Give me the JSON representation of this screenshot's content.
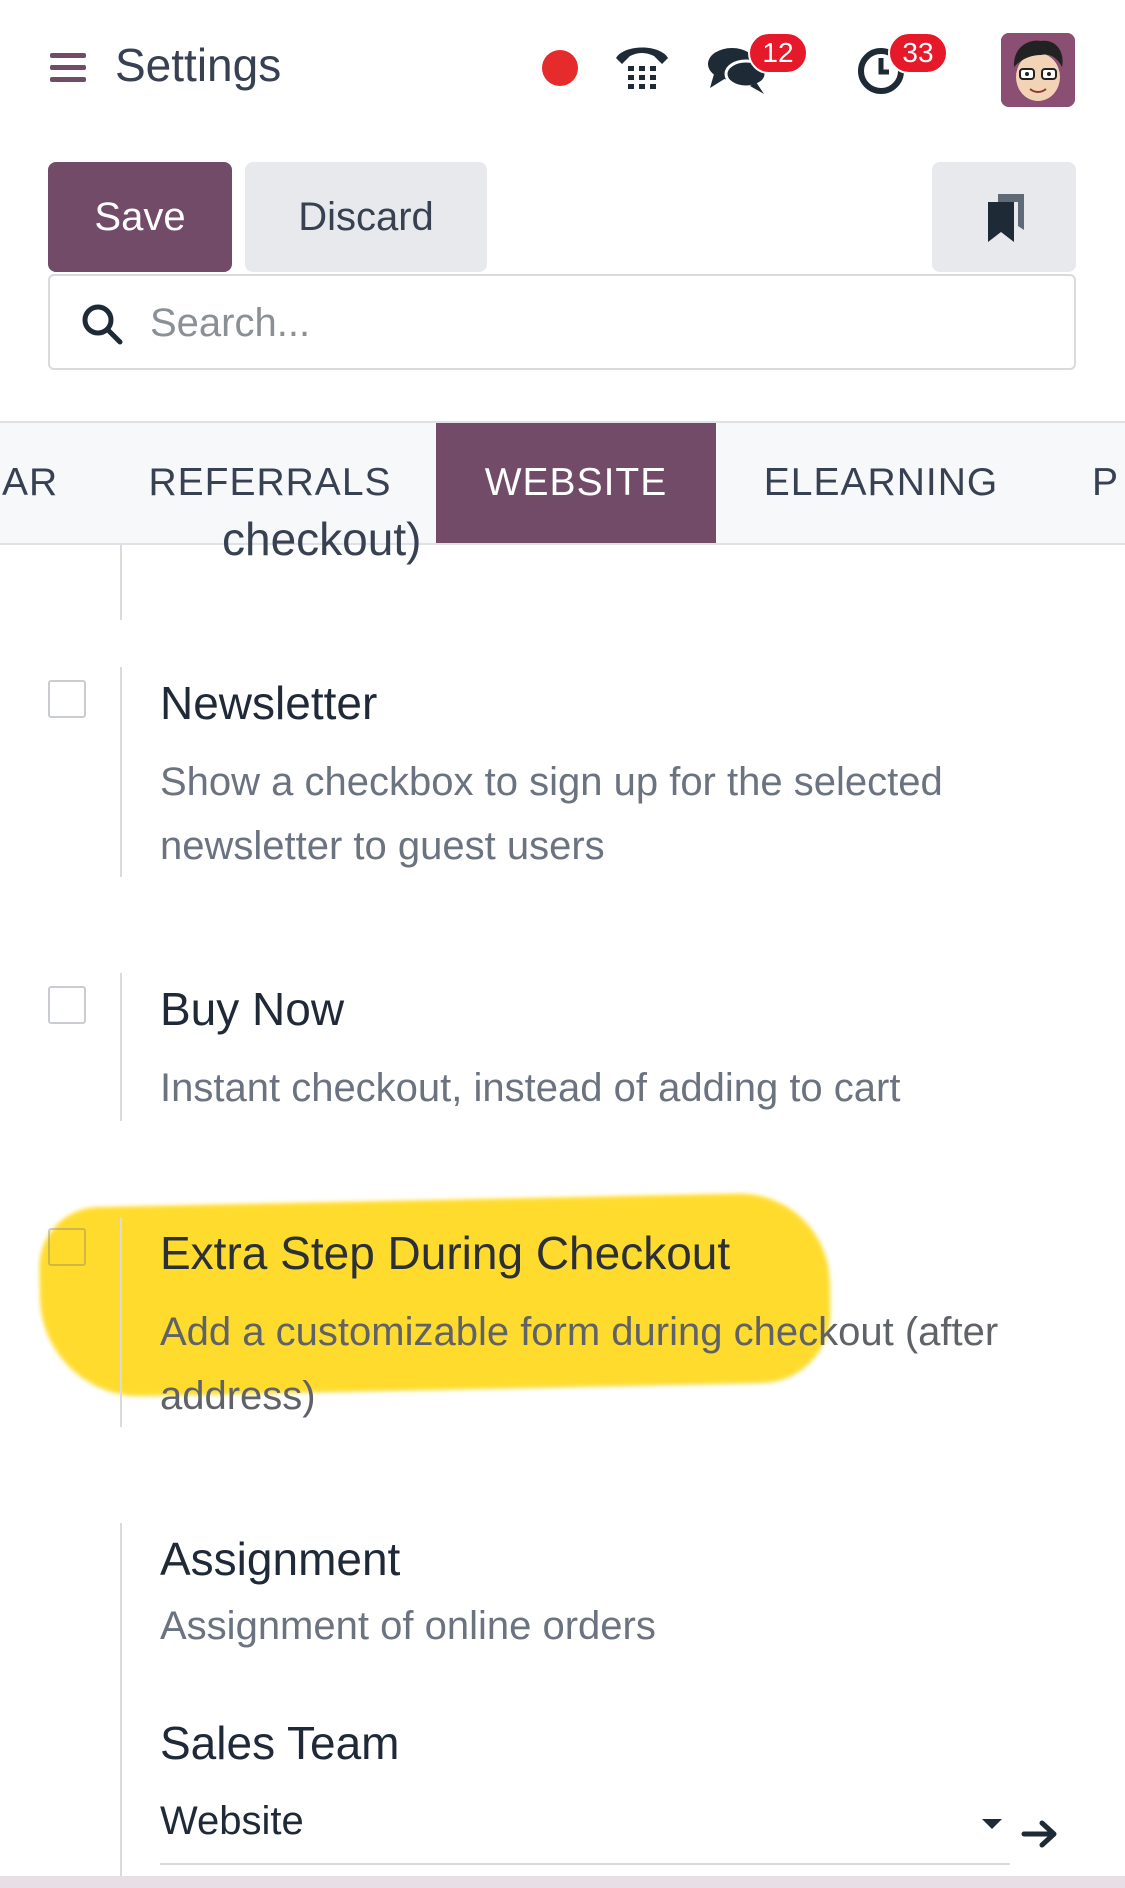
{
  "header": {
    "title": "Settings",
    "messages_count": "12",
    "activities_count": "33"
  },
  "control_panel": {
    "save_label": "Save",
    "discard_label": "Discard",
    "search_placeholder": "Search..."
  },
  "tabs": [
    {
      "label": "AR"
    },
    {
      "label": "REFERRALS"
    },
    {
      "label": "WEBSITE",
      "active": true
    },
    {
      "label": "ELEARNING"
    },
    {
      "label": "P"
    }
  ],
  "settings": {
    "partial_text": "checkout)",
    "newsletter": {
      "title": "Newsletter",
      "description": "Show a checkbox to sign up for the selected newsletter to guest users"
    },
    "buy_now": {
      "title": "Buy Now",
      "description": "Instant checkout, instead of adding to cart"
    },
    "extra_step": {
      "title": "Extra Step During Checkout",
      "description": "Add a customizable form during checkout (after address)"
    },
    "assignment": {
      "title": "Assignment",
      "description": "Assignment of online orders",
      "sales_team_label": "Sales Team",
      "sales_team_value": "Website"
    }
  },
  "colors": {
    "brand": "#714B67",
    "badge": "#e5192a",
    "highlight": "#ffd400",
    "recording_dot": "#e52b2b"
  }
}
